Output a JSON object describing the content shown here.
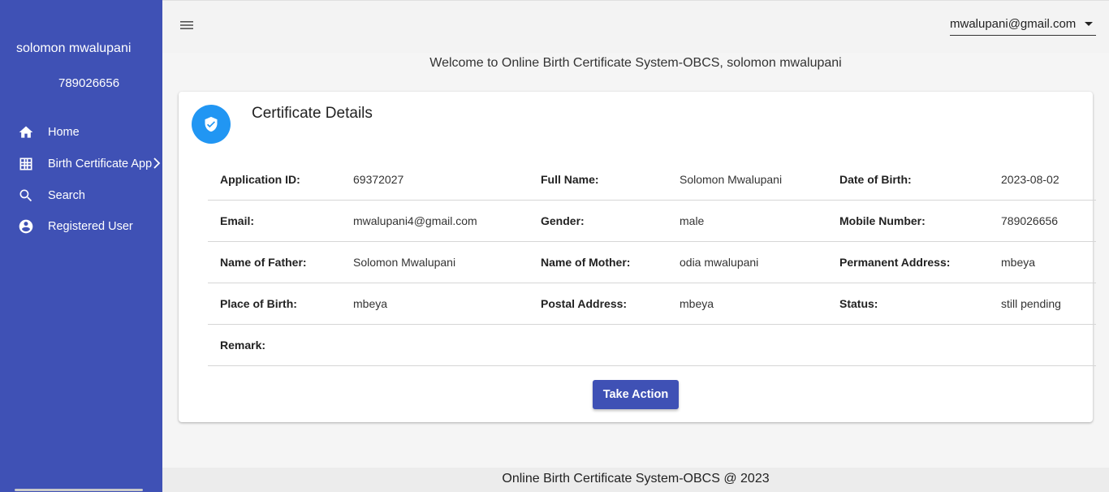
{
  "sidebar": {
    "user_name": "solomon mwalupani",
    "user_phone": "789026656",
    "items": [
      {
        "label": "Home",
        "icon": "home-icon"
      },
      {
        "label": "Birth Certificate App",
        "icon": "grid-icon"
      },
      {
        "label": "Search",
        "icon": "search-icon"
      },
      {
        "label": "Registered User",
        "icon": "account-circle-icon"
      }
    ]
  },
  "header": {
    "account_email": "mwalupani@gmail.com"
  },
  "welcome_text": "Welcome to Online Birth Certificate System-OBCS, solomon mwalupani",
  "card": {
    "title": "Certificate Details",
    "rows": [
      [
        {
          "label": "Application ID:",
          "value": "69372027"
        },
        {
          "label": "Full Name:",
          "value": "Solomon Mwalupani"
        },
        {
          "label": "Date of Birth:",
          "value": "2023-08-02"
        }
      ],
      [
        {
          "label": "Email:",
          "value": "mwalupani4@gmail.com"
        },
        {
          "label": "Gender:",
          "value": "male"
        },
        {
          "label": "Mobile Number:",
          "value": "789026656"
        }
      ],
      [
        {
          "label": "Name of Father:",
          "value": "Solomon Mwalupani"
        },
        {
          "label": "Name of Mother:",
          "value": "odia mwalupani"
        },
        {
          "label": "Permanent Address:",
          "value": "mbeya"
        }
      ],
      [
        {
          "label": "Place of Birth:",
          "value": "mbeya"
        },
        {
          "label": "Postal Address:",
          "value": "mbeya"
        },
        {
          "label": "Status:",
          "value": "still pending"
        }
      ],
      [
        {
          "label": "Remark:",
          "value": ""
        }
      ]
    ],
    "action_label": "Take Action"
  },
  "colors": {
    "primary": "#3f51b5",
    "icon_badge": "#2196f3"
  },
  "footer_text": "Online Birth Certificate System-OBCS @ 2023"
}
